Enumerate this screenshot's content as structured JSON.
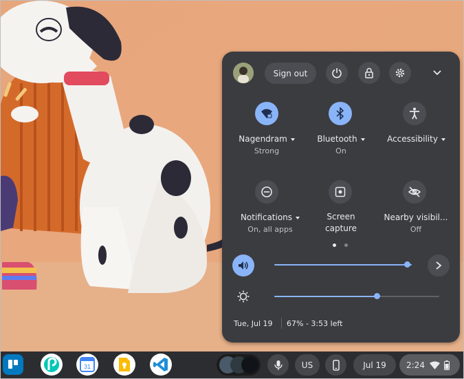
{
  "header": {
    "sign_out_label": "Sign out"
  },
  "tiles": [
    {
      "label": "Nagendram",
      "sub": "Strong",
      "icon": "wifi-icon",
      "state": "on"
    },
    {
      "label": "Bluetooth",
      "sub": "On",
      "icon": "bluetooth-icon",
      "state": "on"
    },
    {
      "label": "Accessibility",
      "sub": "",
      "icon": "accessibility-icon",
      "state": "off"
    },
    {
      "label": "Notifications",
      "sub": "On, all apps",
      "icon": "do-not-disturb-icon",
      "state": "off"
    },
    {
      "label": "Screen",
      "label2": "capture",
      "sub": "",
      "icon": "screen-capture-icon",
      "state": "off"
    },
    {
      "label": "Nearby visibil...",
      "sub": "Off",
      "icon": "eye-off-icon",
      "state": "off"
    }
  ],
  "pagination": {
    "current_page": 1,
    "total_pages": 2
  },
  "volume": {
    "level": 0.98
  },
  "brightness": {
    "level": 0.62
  },
  "footer": {
    "date": "Tue, Jul 19",
    "battery": "67% - 3:53 left"
  },
  "shelf": {
    "apps": [
      "trello-app-icon",
      "picsart-app-icon",
      "google-calendar-app-icon",
      "google-keep-app-icon",
      "vscode-app-icon"
    ],
    "calendar_day": "31",
    "ime_label": "US",
    "date_label": "Jul 19",
    "time_label": "2:24"
  },
  "colors": {
    "accent": "#8ab4f8",
    "panel_bg": "#3b3c40",
    "annotation_arrow": "#e0202a",
    "wallpaper": "#e3a277"
  }
}
